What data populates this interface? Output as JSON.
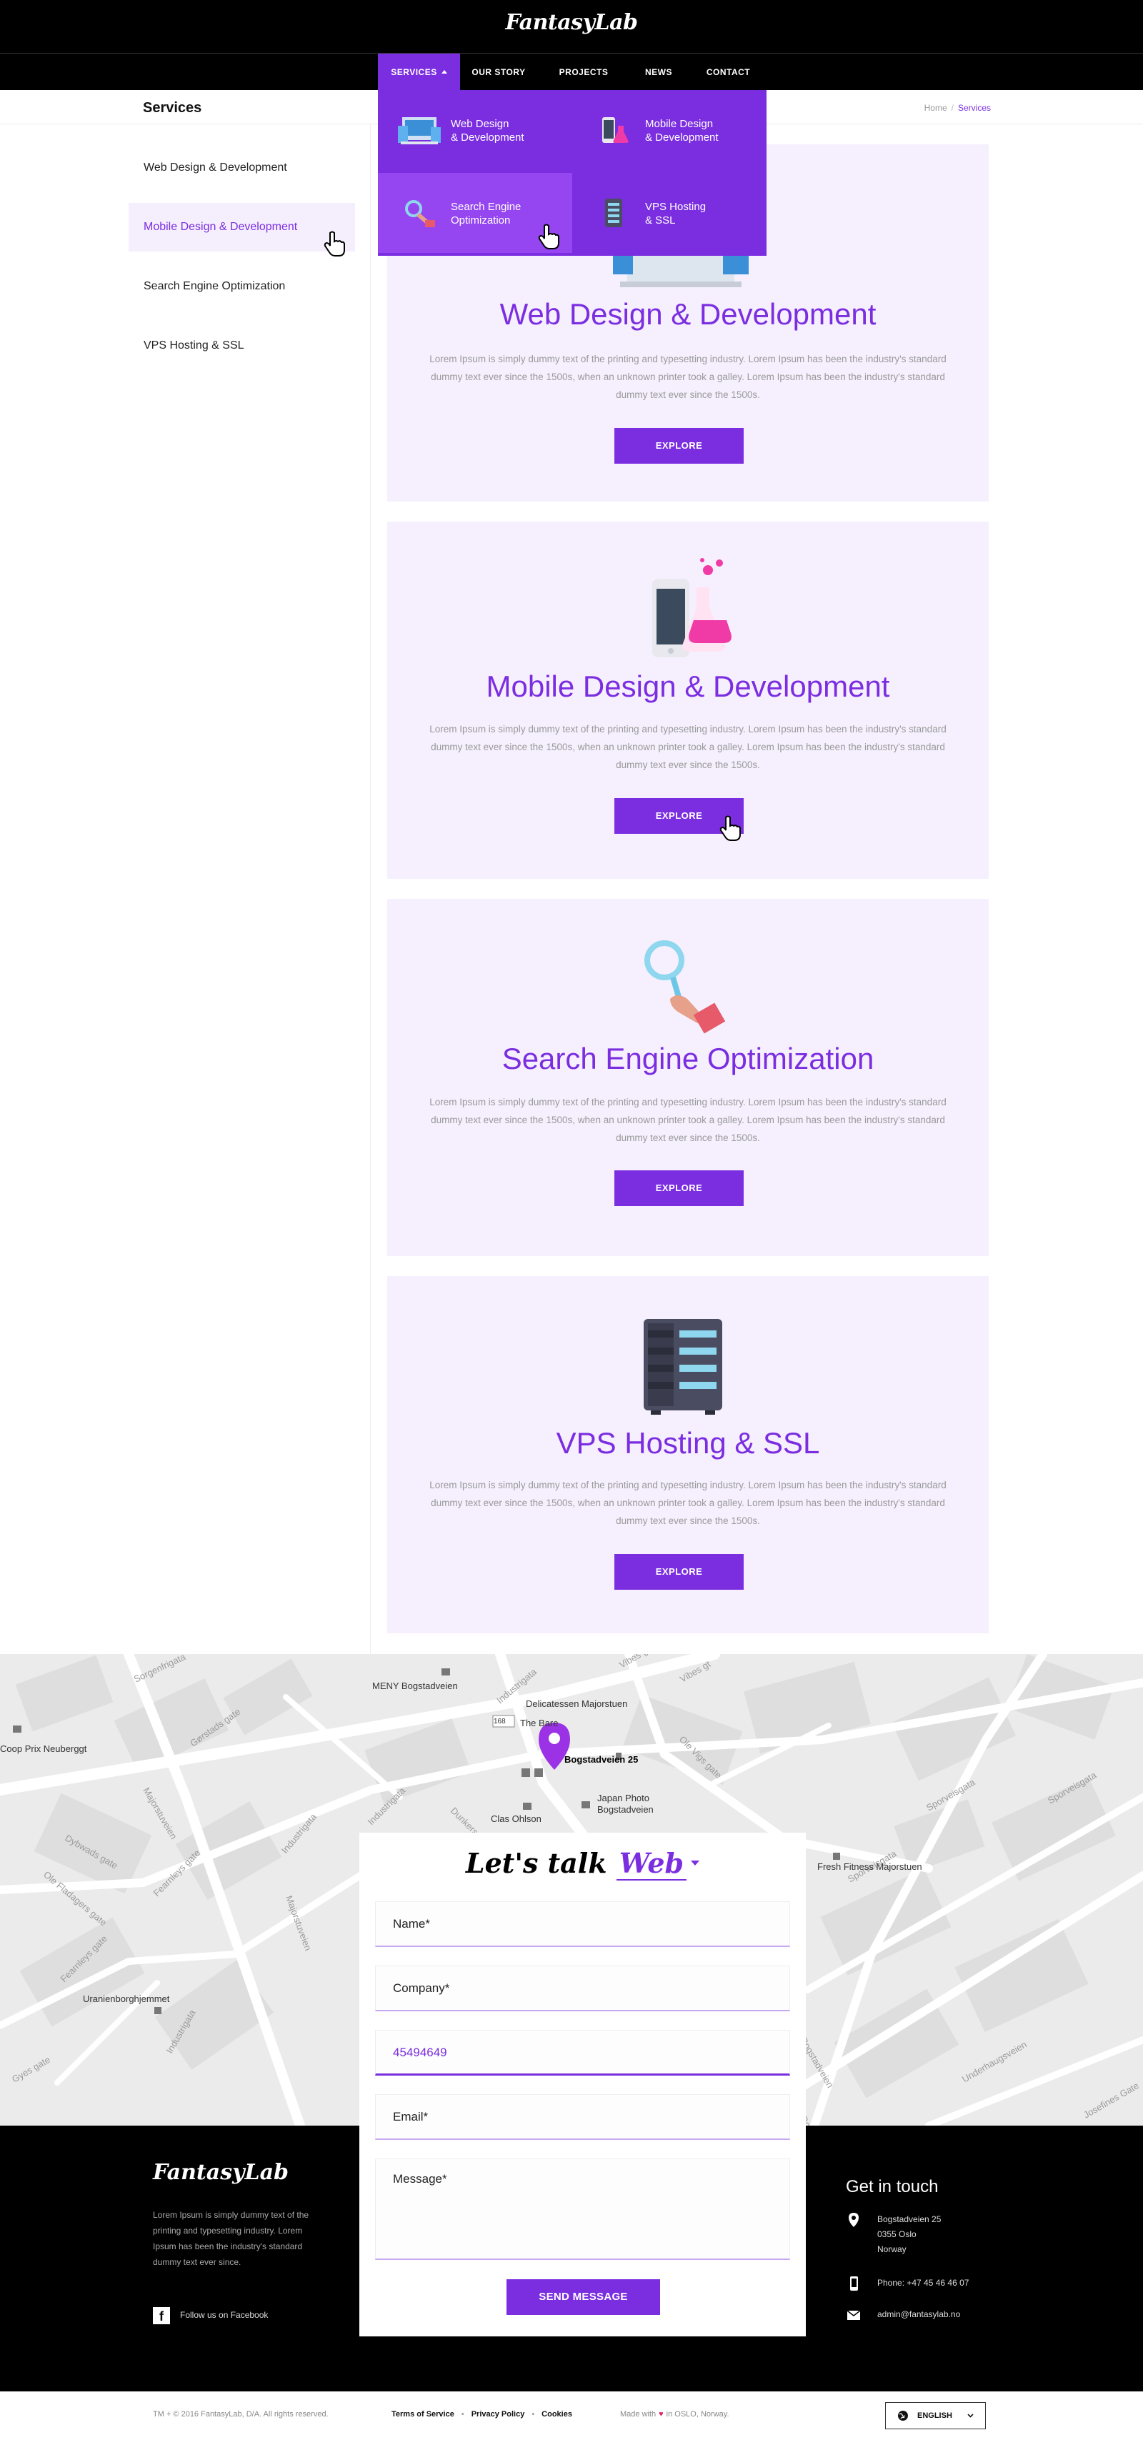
{
  "brand": {
    "name": "FantasyLab"
  },
  "nav": {
    "items": [
      {
        "label": "SERVICES"
      },
      {
        "label": "OUR STORY"
      },
      {
        "label": "PROJECTS"
      },
      {
        "label": "NEWS"
      },
      {
        "label": "CONTACT"
      }
    ]
  },
  "dropdown": {
    "items": [
      {
        "line1": "Web Design",
        "line2": "& Development"
      },
      {
        "line1": "Mobile Design",
        "line2": "& Development"
      },
      {
        "line1": "Search Engine",
        "line2": "Optimization"
      },
      {
        "line1": "VPS Hosting",
        "line2": "& SSL"
      }
    ]
  },
  "page": {
    "title": "Services",
    "breadcrumb": {
      "home": "Home",
      "sep": "/",
      "current": "Services"
    }
  },
  "sidebar": {
    "items": [
      {
        "label": "Web Design & Development"
      },
      {
        "label": "Mobile Design & Development"
      },
      {
        "label": "Search Engine Optimization"
      },
      {
        "label": "VPS Hosting & SSL"
      }
    ]
  },
  "cards": [
    {
      "title": "Web Design & Development",
      "desc": "Lorem Ipsum is simply dummy text of the printing and typesetting industry. Lorem Ipsum has been the industry's standard dummy text ever since the 1500s, when an unknown printer took a galley. Lorem Ipsum has been the industry's standard dummy text ever since the 1500s.",
      "button": "EXPLORE"
    },
    {
      "title": "Mobile Design & Development",
      "desc": "Lorem Ipsum is simply dummy text of the printing and typesetting industry. Lorem Ipsum has been the industry's standard dummy text ever since the 1500s, when an unknown printer took a galley. Lorem Ipsum has been the industry's standard dummy text ever since the 1500s.",
      "button": "EXPLORE"
    },
    {
      "title": "Search Engine Optimization",
      "desc": "Lorem Ipsum is simply dummy text of the printing and typesetting industry. Lorem Ipsum has been the industry's standard dummy text ever since the 1500s, when an unknown printer took a galley. Lorem Ipsum has been the industry's standard dummy text ever since the 1500s.",
      "button": "EXPLORE"
    },
    {
      "title": "VPS Hosting & SSL",
      "desc": "Lorem Ipsum is simply dummy text of the printing and typesetting industry. Lorem Ipsum has been the industry's standard dummy text ever since the 1500s, when an unknown printer took a galley. Lorem Ipsum has been the industry's standard dummy text ever since the 1500s.",
      "button": "EXPLORE"
    }
  ],
  "map": {
    "labels": {
      "meny": "MENY Bogstadveien",
      "delicatessen": "Delicatessen Majorstuen",
      "the_bare": "The Bare",
      "coop": "Coop Prix Neuberggt",
      "pin": "Bogstadveien 25",
      "clas": "Clas Ohlson",
      "japan": "Japan Photo Bogstadveien",
      "fresh": "Fresh Fitness Majorstuen",
      "uranien": "Uranienborghjemmet",
      "road_168": "168"
    }
  },
  "form": {
    "title_prefix": "Let's talk",
    "title_accent": "Web",
    "name_placeholder": "Name*",
    "company_placeholder": "Company*",
    "phone_value": "45494649",
    "email_placeholder": "Email*",
    "message_placeholder": "Message*",
    "send_button": "SEND MESSAGE"
  },
  "footer": {
    "about": "Lorem Ipsum is simply dummy text of the printing and typesetting industry. Lorem Ipsum has been the industry's standard dummy text ever since.",
    "facebook": "Follow us on Facebook",
    "get_in_touch": "Get in touch",
    "address_line1": "Bogstadveien 25",
    "address_line2": "0355 Oslo",
    "address_line3": "Norway",
    "phone": "Phone: +47 45 46 46 07",
    "email": "admin@fantasylab.no"
  },
  "bottom": {
    "copyright": "TM + © 2016 FantasyLab, D/A. All rights reserved.",
    "terms": "Terms of Service",
    "privacy": "Privacy Policy",
    "cookies": "Cookies",
    "made_pre": "Made with",
    "made_post": "in OSLO, Norway.",
    "language": "ENGLISH"
  },
  "colors": {
    "accent": "#7b2ee0",
    "card_bg": "#f6f0fe",
    "dark": "#000000"
  }
}
